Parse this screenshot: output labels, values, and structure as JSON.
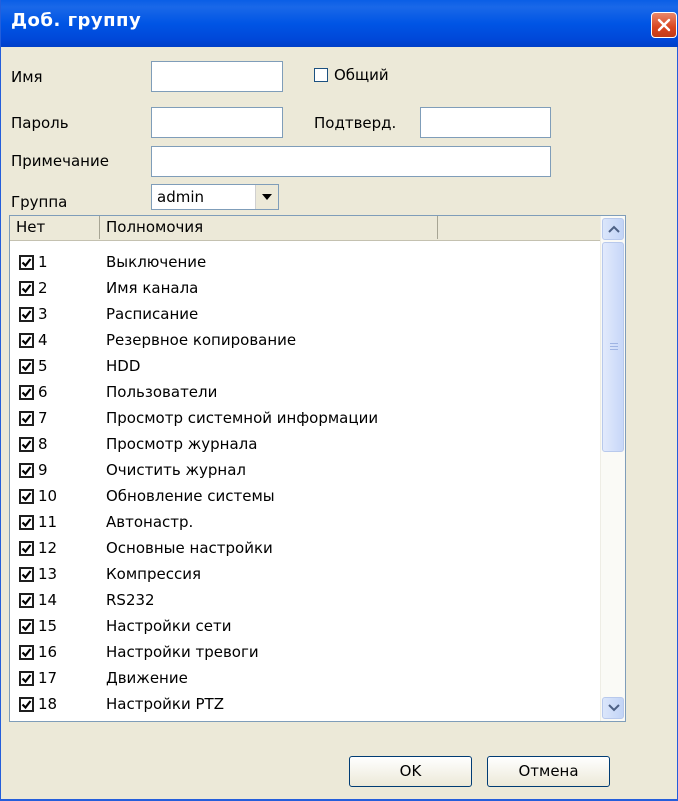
{
  "window": {
    "title": "Доб. группу"
  },
  "form": {
    "name_label": "Имя",
    "name_value": "",
    "shared_label": "Общий",
    "password_label": "Пароль",
    "password_value": "",
    "confirm_label": "Подтверд.",
    "confirm_value": "",
    "note_label": "Примечание",
    "note_value": "",
    "group_label": "Группа",
    "group_value": "admin"
  },
  "list": {
    "columns": [
      "Нет",
      "Полномочия",
      ""
    ],
    "rows": [
      {
        "num": "1",
        "text": "Выключение",
        "checked": true
      },
      {
        "num": "2",
        "text": "Имя канала",
        "checked": true
      },
      {
        "num": "3",
        "text": "Расписание",
        "checked": true
      },
      {
        "num": "4",
        "text": "Резервное копирование",
        "checked": true
      },
      {
        "num": "5",
        "text": "HDD",
        "checked": true
      },
      {
        "num": "6",
        "text": "Пользователи",
        "checked": true
      },
      {
        "num": "7",
        "text": "Просмотр системной информации",
        "checked": true
      },
      {
        "num": "8",
        "text": "Просмотр журнала",
        "checked": true
      },
      {
        "num": "9",
        "text": "Очистить журнал",
        "checked": true
      },
      {
        "num": "10",
        "text": "Обновление системы",
        "checked": true
      },
      {
        "num": "11",
        "text": "Автонастр.",
        "checked": true
      },
      {
        "num": "12",
        "text": "Основные настройки",
        "checked": true
      },
      {
        "num": "13",
        "text": "Компрессия",
        "checked": true
      },
      {
        "num": "14",
        "text": "RS232",
        "checked": true
      },
      {
        "num": "15",
        "text": "Настройки сети",
        "checked": true
      },
      {
        "num": "16",
        "text": "Настройки тревоги",
        "checked": true
      },
      {
        "num": "17",
        "text": "Движение",
        "checked": true
      },
      {
        "num": "18",
        "text": "Настройки PTZ",
        "checked": true
      }
    ]
  },
  "buttons": {
    "ok": "OK",
    "cancel": "Отмена"
  }
}
